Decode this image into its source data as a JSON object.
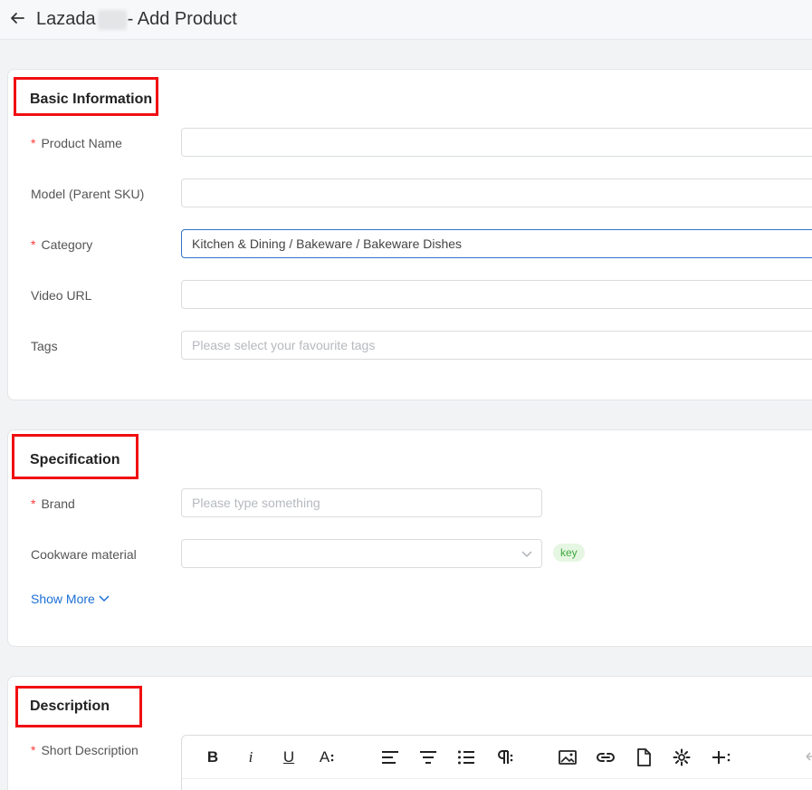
{
  "header": {
    "title_prefix": "Lazada",
    "title_suffix": "- Add Product"
  },
  "basic": {
    "title": "Basic Information",
    "product_name": {
      "label": "Product Name",
      "value": ""
    },
    "model": {
      "label": "Model (Parent SKU)",
      "value": ""
    },
    "category": {
      "label": "Category",
      "value": "Kitchen & Dining / Bakeware / Bakeware Dishes"
    },
    "video": {
      "label": "Video URL",
      "value": ""
    },
    "tags": {
      "label": "Tags",
      "placeholder": "Please select your favourite tags"
    }
  },
  "spec": {
    "title": "Specification",
    "brand": {
      "label": "Brand",
      "placeholder": "Please type something"
    },
    "material": {
      "label": "Cookware material",
      "value": "",
      "badge": "key"
    },
    "show_more": "Show More"
  },
  "desc": {
    "title": "Description",
    "short": {
      "label": "Short Description"
    },
    "toolbar": {
      "bold": "B",
      "italic": "i",
      "underline": "U",
      "font_size": "A"
    }
  },
  "required_mark": "*",
  "colors": {
    "highlight": "#f00f12",
    "link": "#1b6fd4",
    "required": "#ff3b3b",
    "badge_bg": "#e5f7e2",
    "badge_fg": "#3fa83f"
  }
}
